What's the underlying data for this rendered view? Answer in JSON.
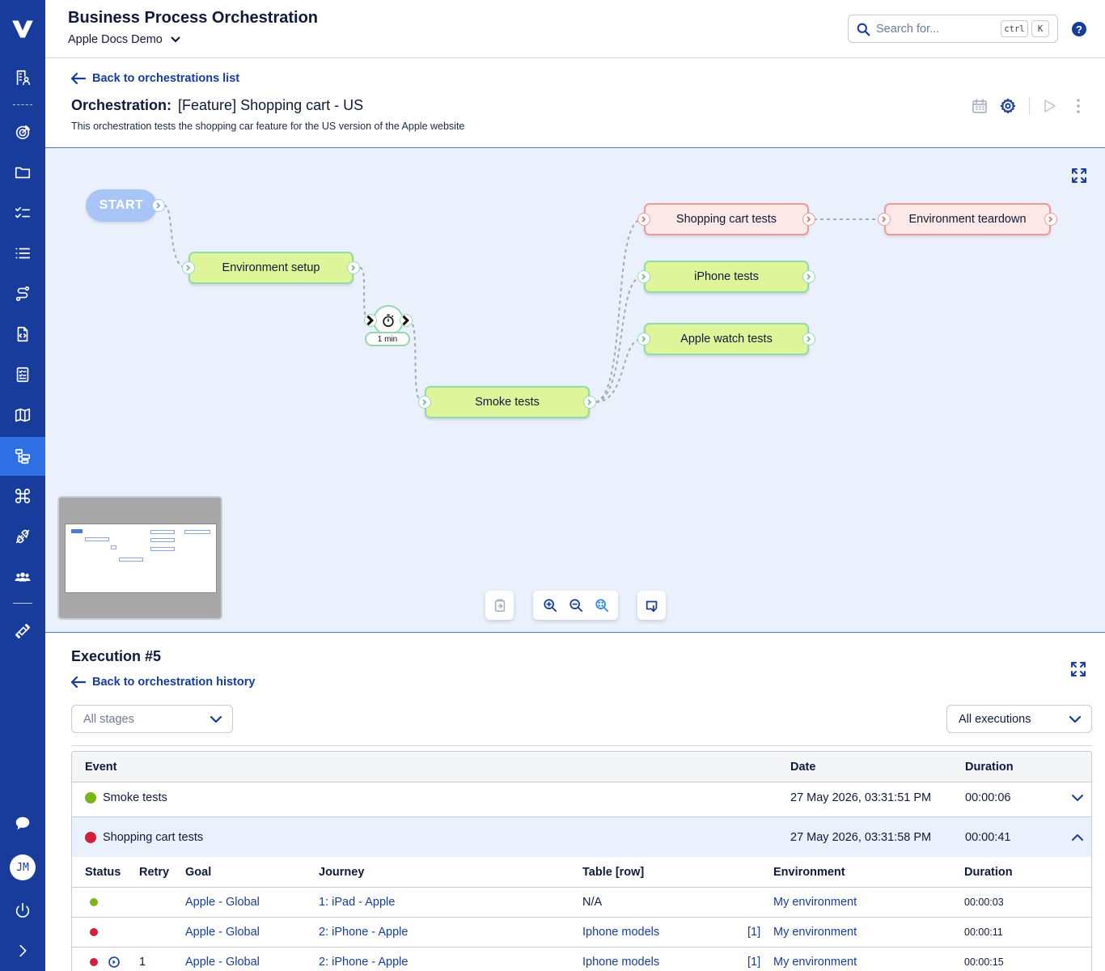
{
  "header": {
    "title": "Business Process Orchestration",
    "project": "Apple Docs Demo",
    "search_placeholder": "Search for...",
    "shortcut_key1": "ctrl",
    "shortcut_key2": "K",
    "help": "?"
  },
  "user": {
    "initials": "JM"
  },
  "sidebar": {
    "icons": [
      "logo-icon",
      "building-user-icon",
      "target-icon",
      "folder-icon",
      "checklist-icon",
      "list-icon",
      "route-icon",
      "code-file-icon",
      "test-case-icon",
      "map-icon",
      "orchestration-icon",
      "command-icon",
      "plug-icon",
      "team-icon",
      "satellite-icon",
      "chat-icon",
      "power-icon",
      "expand-icon"
    ],
    "active": "orchestration-icon",
    "colors": {
      "background": "#173c9c",
      "active": "#2f6fe4"
    }
  },
  "orchestration": {
    "back_label": "Back to orchestrations list",
    "title_prefix": "Orchestration:",
    "name": "[Feature] Shopping cart - US",
    "description": "This orchestration tests the shopping car feature for the US version of the Apple website"
  },
  "flow": {
    "start": "START",
    "nodes": [
      {
        "id": "env-setup",
        "label": "Environment setup",
        "status": "passed"
      },
      {
        "id": "smoke",
        "label": "Smoke tests",
        "status": "passed"
      },
      {
        "id": "cart",
        "label": "Shopping cart tests",
        "status": "failed"
      },
      {
        "id": "iphone",
        "label": "iPhone tests",
        "status": "passed"
      },
      {
        "id": "watch",
        "label": "Apple watch tests",
        "status": "passed"
      },
      {
        "id": "teardown",
        "label": "Environment teardown",
        "status": "failed"
      }
    ],
    "timer_label": "1 min",
    "colors": {
      "passed_fill": "#dff59a",
      "failed_fill": "#fde8e8",
      "start_fill": "#a9c5f7"
    }
  },
  "execution": {
    "title": "Execution #5",
    "back_label": "Back to orchestration history",
    "stages_filter": "All stages",
    "executions_filter": "All executions",
    "columns": {
      "event": "Event",
      "date": "Date",
      "duration": "Duration"
    },
    "events": [
      {
        "status": "passed",
        "name": "Smoke tests",
        "date": "27 May 2026, 03:31:51 PM",
        "duration": "00:00:06"
      },
      {
        "status": "failed",
        "name": "Shopping cart tests",
        "date": "27 May 2026, 03:31:58 PM",
        "duration": "00:00:41"
      }
    ],
    "sub_columns": {
      "status": "Status",
      "retry": "Retry",
      "goal": "Goal",
      "journey": "Journey",
      "table": "Table [row]",
      "environment": "Environment",
      "duration": "Duration"
    },
    "runs": [
      {
        "status": "passed",
        "retry": "",
        "goal": "Apple - Global",
        "journey": "1: iPad - Apple",
        "table": "N/A",
        "row": "",
        "environment": "My environment",
        "duration": "00:00:03"
      },
      {
        "status": "failed",
        "retry": "",
        "goal": "Apple - Global",
        "journey": "2: iPhone - Apple",
        "table": "Iphone models",
        "row": "[1]",
        "environment": "My environment",
        "duration": "00:00:11"
      },
      {
        "status": "failed",
        "retry": "1",
        "goal": "Apple - Global",
        "journey": "2: iPhone - Apple",
        "table": "Iphone models",
        "row": "[1]",
        "environment": "My environment",
        "duration": "00:00:15"
      }
    ],
    "colors": {
      "passed": "#7cb518",
      "failed": "#d21f3c"
    }
  }
}
